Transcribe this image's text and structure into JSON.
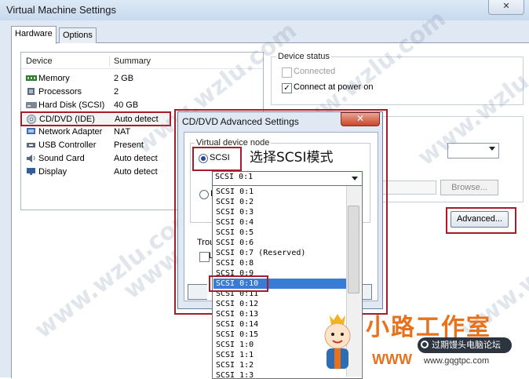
{
  "window": {
    "title": "Virtual Machine Settings",
    "close_glyph": "✕"
  },
  "tabs": [
    {
      "label": "Hardware"
    },
    {
      "label": "Options"
    }
  ],
  "device_list": {
    "headers": {
      "device": "Device",
      "summary": "Summary"
    },
    "rows": [
      {
        "name": "Memory",
        "summary": "2 GB",
        "icon": "memory-icon"
      },
      {
        "name": "Processors",
        "summary": "2",
        "icon": "processor-icon"
      },
      {
        "name": "Hard Disk (SCSI)",
        "summary": "40 GB",
        "icon": "hard-disk-icon"
      },
      {
        "name": "CD/DVD (IDE)",
        "summary": "Auto detect",
        "icon": "cd-dvd-icon"
      },
      {
        "name": "Network Adapter",
        "summary": "NAT",
        "icon": "network-adapter-icon"
      },
      {
        "name": "USB Controller",
        "summary": "Present",
        "icon": "usb-icon"
      },
      {
        "name": "Sound Card",
        "summary": "Auto detect",
        "icon": "sound-card-icon"
      },
      {
        "name": "Display",
        "summary": "Auto detect",
        "icon": "display-icon"
      }
    ]
  },
  "device_status": {
    "label": "Device status",
    "connected": "Connected",
    "connect_at_power_on": "Connect at power on"
  },
  "browse_label": "Browse...",
  "advanced_label": "Advanced...",
  "dialog": {
    "title": "CD/DVD Advanced Settings",
    "close_glyph": "✕",
    "vdn_label": "Virtual device node",
    "scsi_label": "SCSI",
    "radio2_letter": "I",
    "trou_label": "Trou",
    "chk_letter": "L",
    "annotation": "选择SCSI模式",
    "combo_value": "SCSI 0:1",
    "options": [
      "SCSI 0:1",
      "SCSI 0:2",
      "SCSI 0:3",
      "SCSI 0:4",
      "SCSI 0:5",
      "SCSI 0:6",
      "SCSI 0:7  (Reserved)",
      "SCSI 0:8",
      "SCSI 0:9",
      "SCSI 0:10",
      "SCSI 0:11",
      "SCSI 0:12",
      "SCSI 0:13",
      "SCSI 0:14",
      "SCSI 0:15",
      "SCSI 1:0",
      "SCSI 1:1",
      "SCSI 1:2",
      "SCSI 1:3"
    ],
    "selected_option": "SCSI 0:10"
  },
  "watermarks": {
    "text": "www.wzlu.com",
    "brand": "小路工作室",
    "forum_badge": "过期馒头电脑论坛",
    "site": "www.gqgtpc.com",
    "www": "WWW"
  },
  "colors": {
    "highlight_outline": "#a61c2a",
    "selection": "#3a7bd5"
  }
}
